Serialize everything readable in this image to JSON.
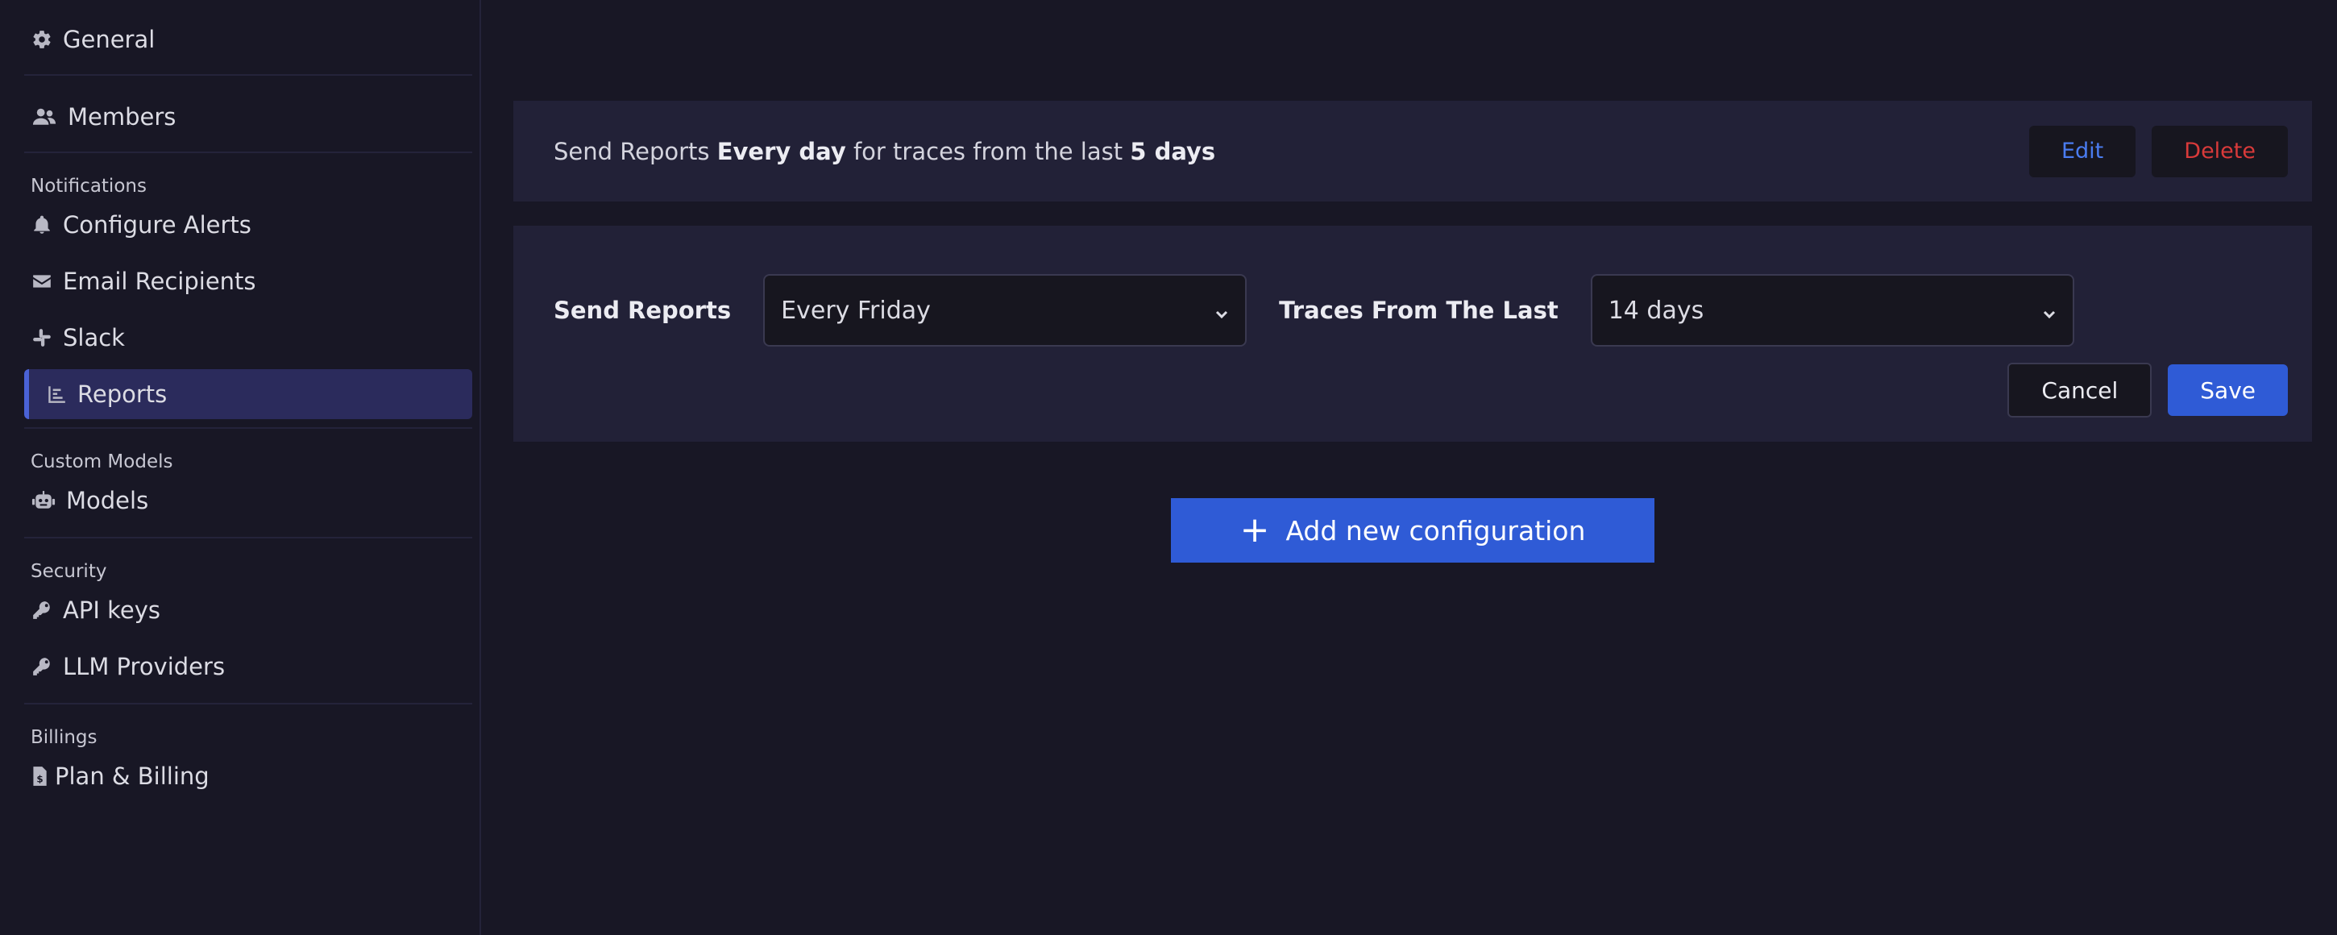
{
  "sidebar": {
    "general": "General",
    "members": "Members",
    "notifications_label": "Notifications",
    "configure_alerts": "Configure Alerts",
    "email_recipients": "Email Recipients",
    "slack": "Slack",
    "reports": "Reports",
    "custom_models_label": "Custom Models",
    "models": "Models",
    "security_label": "Security",
    "api_keys": "API keys",
    "llm_providers": "LLM Providers",
    "billings_label": "Billings",
    "plan_billing": "Plan & Billing"
  },
  "summary": {
    "prefix": "Send Reports",
    "frequency": "Every day",
    "middle": "for traces from the last",
    "range": "5 days",
    "edit_label": "Edit",
    "delete_label": "Delete"
  },
  "form": {
    "send_reports_label": "Send Reports",
    "send_reports_value": "Every Friday",
    "traces_label": "Traces From The Last",
    "traces_value": "14 days",
    "cancel_label": "Cancel",
    "save_label": "Save"
  },
  "add_button": {
    "icon": "+",
    "label": "Add new configuration"
  },
  "colors": {
    "background": "#181725",
    "card": "#222137",
    "primary": "#2f5bd6",
    "edit": "#4a7cf0",
    "delete": "#d93a3a",
    "active_nav": "#2b2b5c"
  },
  "icons": {
    "general": "gear-icon",
    "members": "users-icon",
    "configure_alerts": "bell-icon",
    "email_recipients": "envelope-icon",
    "slack": "slack-icon",
    "reports": "chart-icon",
    "models": "robot-icon",
    "api_keys": "key-icon",
    "llm_providers": "key-icon",
    "plan_billing": "billing-icon"
  }
}
